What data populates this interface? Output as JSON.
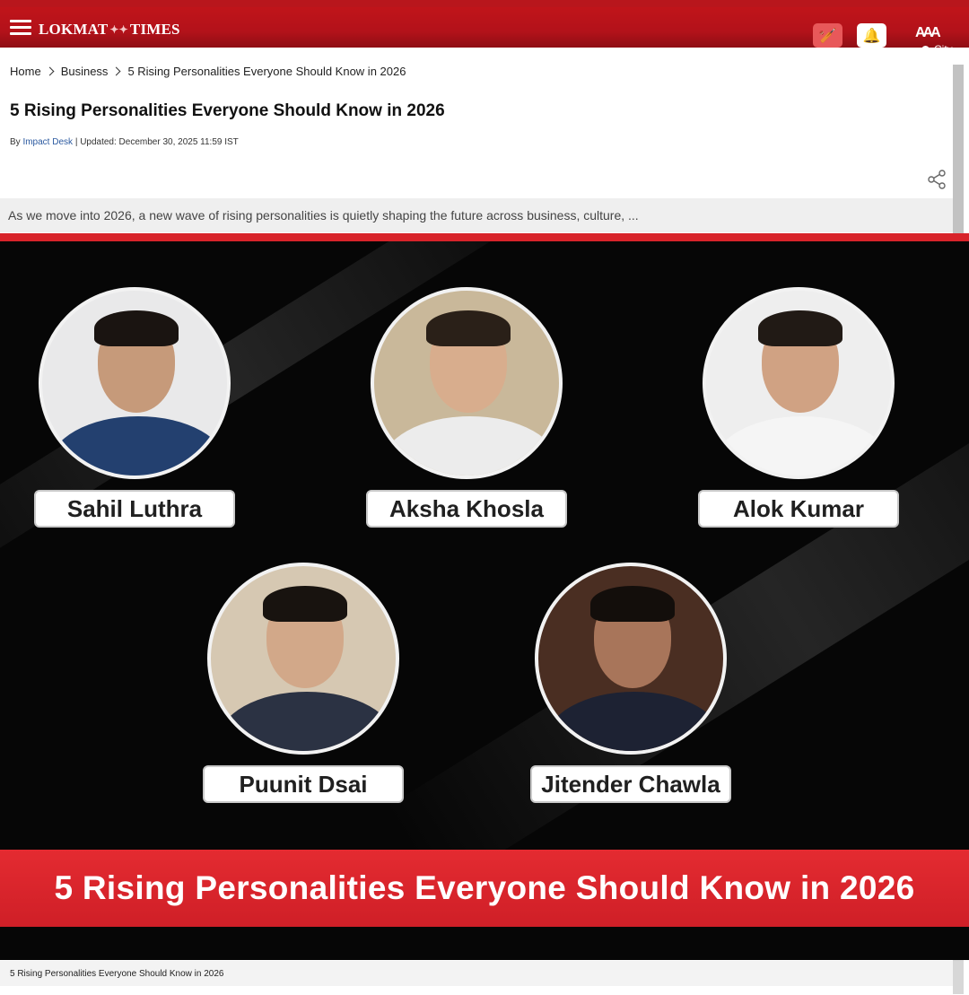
{
  "header": {
    "logo_left": "LOKMAT",
    "logo_mid": "✦✦",
    "logo_right": "TIMES",
    "font_size_label": "AAA",
    "city_label": "City",
    "brand_color": "#b8161c"
  },
  "breadcrumb": {
    "items": [
      "Home",
      "Business",
      "5 Rising Personalities Everyone Should Know in 2026"
    ]
  },
  "article": {
    "title": "5 Rising Personalities Everyone Should Know in 2026",
    "by_label": "By",
    "author": "Impact Desk",
    "updated": "| Updated: December 30, 2025 11:59 IST",
    "summary": "As we move into 2026, a new wave of rising personalities is quietly shaping the future across business, culture, ...",
    "caption": "5 Rising Personalities Everyone Should Know in 2026"
  },
  "hero_image": {
    "people": [
      {
        "name": "Sahil Luthra"
      },
      {
        "name": "Aksha Khosla"
      },
      {
        "name": "Alok Kumar"
      },
      {
        "name": "Puunit Dsai"
      },
      {
        "name": "Jitender Chawla"
      }
    ],
    "banner": "5 Rising Personalities Everyone Should Know in 2026",
    "banner_color": "#d8232a"
  }
}
